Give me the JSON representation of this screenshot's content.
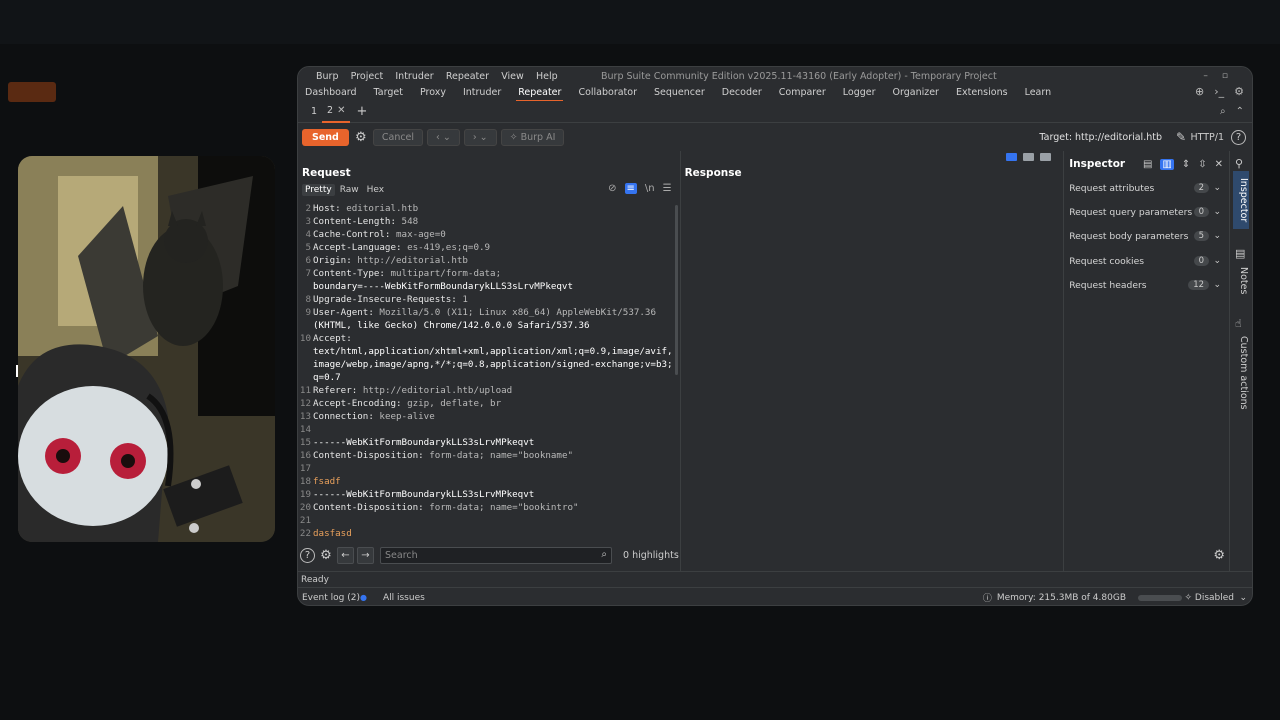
{
  "app": {
    "menu": [
      "Burp",
      "Project",
      "Intruder",
      "Repeater",
      "View",
      "Help"
    ],
    "title": "Burp Suite Community Edition v2025.11-43160 (Early Adopter) - Temporary Project",
    "tabs": [
      "Dashboard",
      "Target",
      "Proxy",
      "Intruder",
      "Repeater",
      "Collaborator",
      "Sequencer",
      "Decoder",
      "Comparer",
      "Logger",
      "Organizer",
      "Extensions",
      "Learn"
    ],
    "active_tab": "Repeater"
  },
  "repeater": {
    "subtabs": [
      "1",
      "2"
    ],
    "active_subtab": "2",
    "send_label": "Send",
    "cancel_label": "Cancel",
    "burp_ai_label": "Burp AI",
    "target_label": "Target: http://editorial.htb",
    "protocol": "HTTP/1"
  },
  "request": {
    "title": "Request",
    "view_tabs": [
      "Pretty",
      "Raw",
      "Hex"
    ],
    "active_view": "Pretty",
    "newline_toggle": "\\n",
    "lines": [
      {
        "n": "2",
        "k": "Host",
        "v": "editorial.htb"
      },
      {
        "n": "3",
        "k": "Content-Length",
        "v": "548"
      },
      {
        "n": "4",
        "k": "Cache-Control",
        "v": "max-age=0"
      },
      {
        "n": "5",
        "k": "Accept-Language",
        "v": "es-419,es;q=0.9"
      },
      {
        "n": "6",
        "k": "Origin",
        "v": "http://editorial.htb"
      },
      {
        "n": "7",
        "k": "Content-Type",
        "v": "multipart/form-data;"
      },
      {
        "n": "",
        "k": "",
        "v": "boundary=----WebKitFormBoundarykLLS3sLrvMPkeqvt"
      },
      {
        "n": "8",
        "k": "Upgrade-Insecure-Requests",
        "v": "1"
      },
      {
        "n": "9",
        "k": "User-Agent",
        "v": "Mozilla/5.0 (X11; Linux x86_64) AppleWebKit/537.36"
      },
      {
        "n": "",
        "k": "",
        "v": "(KHTML, like Gecko) Chrome/142.0.0.0 Safari/537.36"
      },
      {
        "n": "10",
        "k": "Accept",
        "v": ""
      },
      {
        "n": "",
        "k": "",
        "v": "text/html,application/xhtml+xml,application/xml;q=0.9,image/avif,"
      },
      {
        "n": "",
        "k": "",
        "v": "image/webp,image/apng,*/*;q=0.8,application/signed-exchange;v=b3;"
      },
      {
        "n": "",
        "k": "",
        "v": "q=0.7"
      },
      {
        "n": "11",
        "k": "Referer",
        "v": "http://editorial.htb/upload"
      },
      {
        "n": "12",
        "k": "Accept-Encoding",
        "v": "gzip, deflate, br"
      },
      {
        "n": "13",
        "k": "Connection",
        "v": "keep-alive"
      },
      {
        "n": "14",
        "k": "",
        "v": ""
      },
      {
        "n": "15",
        "k": "",
        "v": "------WebKitFormBoundarykLLS3sLrvMPkeqvt"
      },
      {
        "n": "16",
        "k": "Content-Disposition",
        "v": "form-data; name=\"bookname\""
      },
      {
        "n": "17",
        "k": "",
        "v": ""
      },
      {
        "n": "18",
        "k": "",
        "v": "fsadf",
        "orange": true
      },
      {
        "n": "19",
        "k": "",
        "v": "------WebKitFormBoundarykLLS3sLrvMPkeqvt"
      },
      {
        "n": "20",
        "k": "Content-Disposition",
        "v": "form-data; name=\"bookintro\""
      },
      {
        "n": "21",
        "k": "",
        "v": ""
      },
      {
        "n": "22",
        "k": "",
        "v": "dasfasd",
        "orange": true
      }
    ],
    "search_placeholder": "Search",
    "highlights": "0 highlights"
  },
  "response": {
    "title": "Response"
  },
  "inspector": {
    "title": "Inspector",
    "rows": [
      {
        "label": "Request attributes",
        "count": "2"
      },
      {
        "label": "Request query parameters",
        "count": "0"
      },
      {
        "label": "Request body parameters",
        "count": "5"
      },
      {
        "label": "Request cookies",
        "count": "0"
      },
      {
        "label": "Request headers",
        "count": "12"
      }
    ]
  },
  "side_tabs": [
    "Inspector",
    "Notes",
    "Custom actions"
  ],
  "status": {
    "ready": "Ready",
    "event_log": "Event log (2)",
    "all_issues": "All issues",
    "memory": "Memory: 215.3MB of 4.80GB",
    "disabled": "Disabled"
  }
}
